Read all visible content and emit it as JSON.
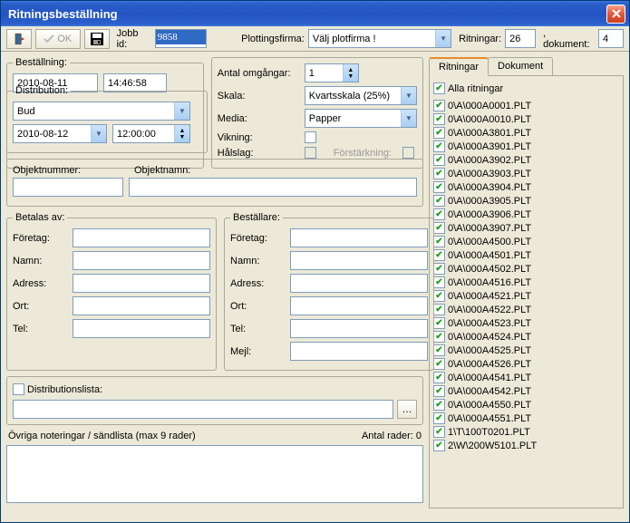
{
  "window": {
    "title": "Ritningsbeställning"
  },
  "toolbar": {
    "ok_label": "OK",
    "jobb_id_label": "Jobb id:",
    "jobb_id_value": "9858",
    "plottingsfirma_label": "Plottingsfirma:",
    "plottingsfirma_value": "Välj plotfirma !",
    "ritningar_label": "Ritningar:",
    "ritningar_value": "26",
    "dokument_label": ", dokument:",
    "dokument_value": "4"
  },
  "bestallning": {
    "legend": "Beställning:",
    "date": "2010-08-11",
    "time": "14:46:58"
  },
  "distribution": {
    "legend": "Distribution:",
    "method": "Bud",
    "date": "2010-08-12",
    "time": "12:00:00"
  },
  "print": {
    "antal_omgangar_label": "Antal omgångar:",
    "antal_omgangar_value": "1",
    "skala_label": "Skala:",
    "skala_value": "Kvartsskala (25%)",
    "media_label": "Media:",
    "media_value": "Papper",
    "vikning_label": "Vikning:",
    "halslag_label": "Hålslag:",
    "forstarkning_label": "Förstärkning:"
  },
  "objekt": {
    "nummer_label": "Objektnummer:",
    "namn_label": "Objektnamn:"
  },
  "betalas": {
    "legend": "Betalas av:",
    "foretag": "Företag:",
    "namn": "Namn:",
    "adress": "Adress:",
    "ort": "Ort:",
    "tel": "Tel:"
  },
  "bestallare": {
    "legend": "Beställare:",
    "foretag": "Företag:",
    "namn": "Namn:",
    "adress": "Adress:",
    "ort": "Ort:",
    "tel": "Tel:",
    "mejl": "Mejl:"
  },
  "distlista": {
    "label": "Distributionslista:"
  },
  "noteringar": {
    "label": "Övriga noteringar / sändlista (max 9 rader)",
    "antal_label": "Antal rader: 0"
  },
  "tabs": {
    "ritningar": "Ritningar",
    "dokument": "Dokument",
    "alla": "Alla ritningar"
  },
  "files": [
    "0\\A\\000A0001.PLT",
    "0\\A\\000A0010.PLT",
    "0\\A\\000A3801.PLT",
    "0\\A\\000A3901.PLT",
    "0\\A\\000A3902.PLT",
    "0\\A\\000A3903.PLT",
    "0\\A\\000A3904.PLT",
    "0\\A\\000A3905.PLT",
    "0\\A\\000A3906.PLT",
    "0\\A\\000A3907.PLT",
    "0\\A\\000A4500.PLT",
    "0\\A\\000A4501.PLT",
    "0\\A\\000A4502.PLT",
    "0\\A\\000A4516.PLT",
    "0\\A\\000A4521.PLT",
    "0\\A\\000A4522.PLT",
    "0\\A\\000A4523.PLT",
    "0\\A\\000A4524.PLT",
    "0\\A\\000A4525.PLT",
    "0\\A\\000A4526.PLT",
    "0\\A\\000A4541.PLT",
    "0\\A\\000A4542.PLT",
    "0\\A\\000A4550.PLT",
    "0\\A\\000A4551.PLT",
    "1\\T\\100T0201.PLT",
    "2\\W\\200W5101.PLT"
  ]
}
